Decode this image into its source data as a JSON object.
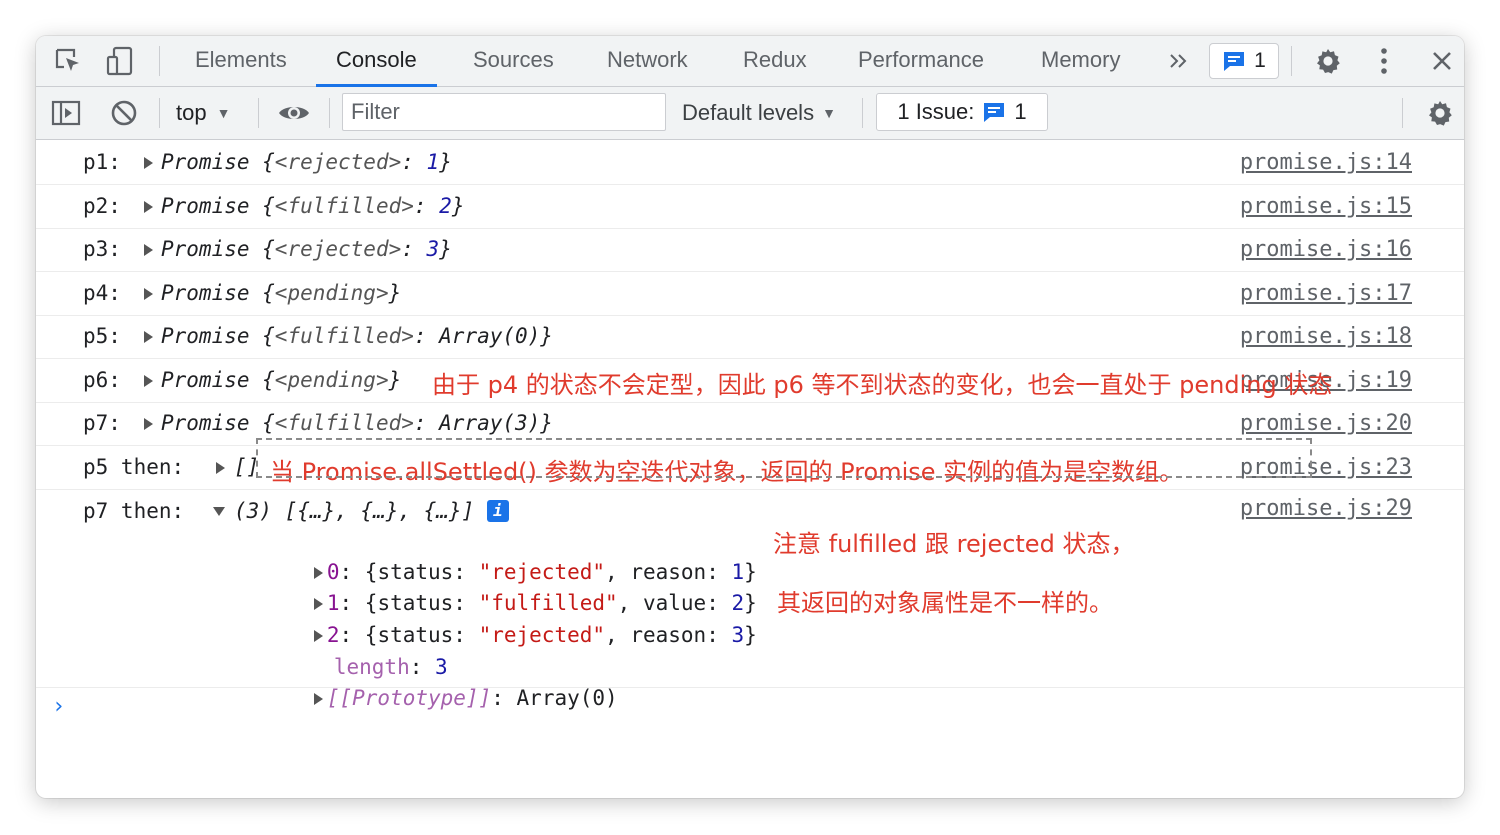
{
  "tabs": [
    {
      "label": "Elements",
      "name": "tab-elements"
    },
    {
      "label": "Console",
      "name": "tab-console"
    },
    {
      "label": "Sources",
      "name": "tab-sources"
    },
    {
      "label": "Network",
      "name": "tab-network"
    },
    {
      "label": "Redux",
      "name": "tab-redux"
    },
    {
      "label": "Performance",
      "name": "tab-performance"
    },
    {
      "label": "Memory",
      "name": "tab-memory"
    }
  ],
  "active_tab": "Console",
  "message_count": "1",
  "toolbar": {
    "context": "top",
    "filter_placeholder": "Filter",
    "levels": "Default levels",
    "issues_label": "1 Issue:",
    "issues_count": "1"
  },
  "rows": [
    {
      "label": "p1: ",
      "obj": "Promise {<rejected>: 1}",
      "src": "promise.js:14"
    },
    {
      "label": "p2: ",
      "obj": "Promise {<fulfilled>: 2}",
      "src": "promise.js:15"
    },
    {
      "label": "p3: ",
      "obj": "Promise {<rejected>: 3}",
      "src": "promise.js:16"
    },
    {
      "label": "p4: ",
      "obj": "Promise {<pending>}",
      "src": "promise.js:17"
    },
    {
      "label": "p5: ",
      "obj": "Promise {<fulfilled>: Array(0)}",
      "src": "promise.js:18"
    },
    {
      "label": "p6: ",
      "obj": "Promise {<pending>}",
      "src": "promise.js:19"
    },
    {
      "label": "p7: ",
      "obj": "Promise {<fulfilled>: Array(3)}",
      "src": "promise.js:20"
    },
    {
      "label": "p5 then: ",
      "obj": "[]",
      "src": "promise.js:23"
    },
    {
      "label": "p7 then: ",
      "obj": "(3) [{…}, {…}, {…}]",
      "src": "promise.js:29"
    }
  ],
  "p7_then": {
    "items": [
      {
        "index": "0",
        "status": "\"rejected\"",
        "key": "reason",
        "value": "1"
      },
      {
        "index": "1",
        "status": "\"fulfilled\"",
        "key": "value",
        "value": "2"
      },
      {
        "index": "2",
        "status": "\"rejected\"",
        "key": "reason",
        "value": "3"
      }
    ],
    "length_key": "length",
    "length_value": "3",
    "prototype_key": "[[Prototype]]",
    "prototype_value": "Array(0)"
  },
  "annotations": {
    "p6": "由于 p4 的状态不会定型，因此 p6 等不到状态的变化，也会一直处于 pending 状态",
    "p5": "当 Promise.allSettled() 参数为空迭代对象，返回的 Promise 实例的值为是空数组。",
    "p7_line1": "注意 fulfilled 跟 rejected 状态，",
    "p7_line2": "其返回的对象属性是不一样的。"
  },
  "colors": {
    "accent": "#1a73e8",
    "annotation": "#e03b2d",
    "number": "#1a1aa6",
    "string": "#c41a16",
    "key": "#881391"
  }
}
